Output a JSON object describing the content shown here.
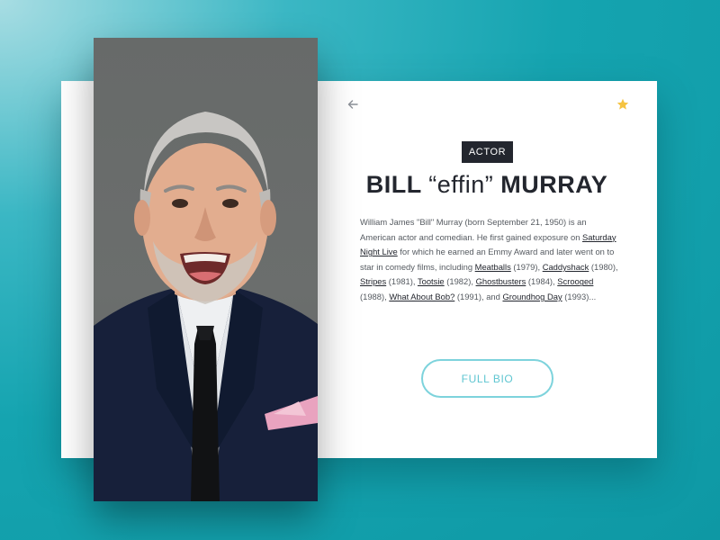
{
  "profile": {
    "tag": "ACTOR",
    "name_first": "BILL",
    "name_nick": "“effin”",
    "name_last": "MURRAY",
    "full_bio_label": "FULL BIO"
  },
  "bio": {
    "t1": "William James \"Bill\" Murray (born September 21, 1950) is an American actor and comedian. He first gained exposure on ",
    "l1": "Saturday Night Live",
    "t2": " for which he earned an Emmy Award and later went on to star in comedy films, including ",
    "l2": "Meatballs",
    "t3": " (1979), ",
    "l3": "Caddyshack",
    "t4": " (1980), ",
    "l4": "Stripes",
    "t5": " (1981), ",
    "l5": "Tootsie",
    "t6": " (1982), ",
    "l6": "Ghostbusters",
    "t7": " (1984), ",
    "l7": "Scrooged",
    "t8": " (1988), ",
    "l8": "What About Bob?",
    "t9": " (1991), and ",
    "l9": "Groundhog Day",
    "t10": " (1993)..."
  },
  "icons": {
    "back": "arrow-left-icon",
    "favorite": "star-icon"
  },
  "colors": {
    "background": "#15a4b0",
    "card": "#ffffff",
    "tag_bg": "#23262e",
    "button_accent": "#7dd3dc",
    "star": "#f5c341"
  }
}
